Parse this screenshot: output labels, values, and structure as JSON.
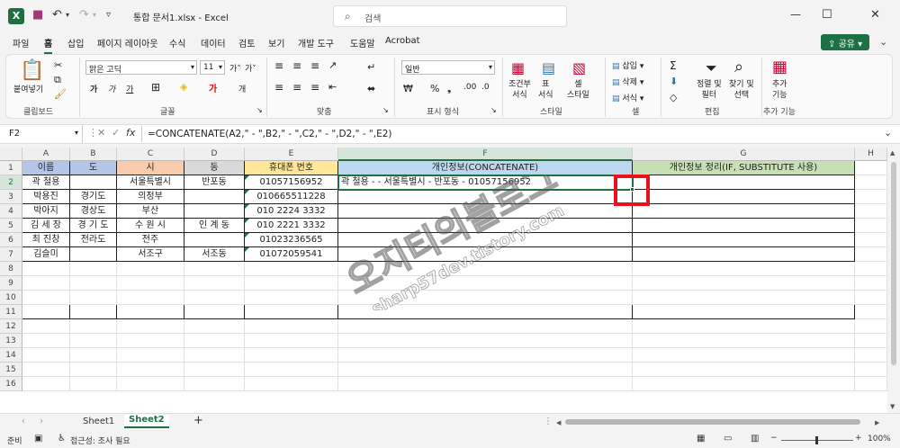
{
  "titlebar": {
    "doc_title": "통합 문서1.xlsx  -  Excel",
    "search_placeholder": "검색",
    "search_icon": "search-icon",
    "qat_icons": [
      "save-icon",
      "undo-icon",
      "redo-icon"
    ]
  },
  "menu": {
    "tabs": [
      "파일",
      "홈",
      "삽입",
      "페이지 레이아웃",
      "수식",
      "데이터",
      "검토",
      "보기",
      "개발 도구",
      "도움말",
      "Acrobat"
    ],
    "active": "홈",
    "share_label": "공유"
  },
  "ribbon": {
    "clipboard": {
      "paste": "붙여넣기",
      "label": "클립보드"
    },
    "font": {
      "name": "맑은 고딕",
      "size": "11",
      "bold": "가",
      "italic": "가",
      "underline": "가",
      "label": "글꼴"
    },
    "align": {
      "label": "맞춤"
    },
    "number": {
      "format": "일반",
      "label": "표시 형식"
    },
    "styles": {
      "cond_format": "조건부\n서식",
      "table_format": "표\n서식",
      "cell_style": "셀\n스타일",
      "label": "스타일"
    },
    "cells": {
      "insert": "삽입",
      "delete": "삭제",
      "format": "서식",
      "label": "셀"
    },
    "editing": {
      "sort_filter": "정렬 및\n필터",
      "find_select": "찾기 및\n선택",
      "label": "편집"
    },
    "addins": {
      "addins": "추가\n기능",
      "label": "추가 기능"
    }
  },
  "formula_bar": {
    "name_box": "F2",
    "fx": "fx",
    "formula": "=CONCATENATE(A2,\" - \",B2,\" - \",C2,\" - \",D2,\" - \",E2)"
  },
  "sheet": {
    "columns": [
      "A",
      "B",
      "C",
      "D",
      "E",
      "F",
      "G",
      "H"
    ],
    "selected_column": "F",
    "selected_row": "2",
    "rows": [
      "1",
      "2",
      "3",
      "4",
      "5",
      "6",
      "7",
      "8",
      "9",
      "10",
      "11",
      "12",
      "13",
      "14",
      "15",
      "16"
    ],
    "header_row": [
      "이름",
      "도",
      "시",
      "동",
      "휴대폰 번호",
      "개인정보(CONCATENATE)",
      "개인정보 정리(IF, SUBSTITUTE 사용)"
    ],
    "header_colors": [
      "#b4c6e7",
      "#b4c6e7",
      "#f8cbad",
      "#d9d9d9",
      "#ffe699",
      "#bdd7ee",
      "#c6e0b4"
    ],
    "data": [
      [
        "곽 철용",
        "",
        "서울특별시",
        "반포동",
        "01057156952",
        "곽 철용 -  - 서울특별시 - 반포동 - 01057156952",
        ""
      ],
      [
        "박용진",
        "경기도",
        "의정부",
        "",
        "010665511228",
        "",
        ""
      ],
      [
        "박아지",
        "경상도",
        "부산",
        "",
        "010 2224 3332",
        "",
        ""
      ],
      [
        "김 세 장",
        "경 기 도",
        "수 원 시",
        "인 계 동",
        "010 2221 3332",
        "",
        ""
      ],
      [
        "최 진창",
        "전라도",
        "전주",
        "",
        "01023236565",
        "",
        ""
      ],
      [
        "김슬미",
        "",
        "서조구",
        "서조동",
        "01072059541",
        "",
        ""
      ]
    ],
    "watermark": "오지티의블로그",
    "watermark_url": "sharp57dev.tistory.com"
  },
  "sheets": {
    "tabs": [
      "Sheet1",
      "Sheet2"
    ],
    "active": "Sheet2",
    "add": "+"
  },
  "status": {
    "ready": "준비",
    "accessibility": "접근성: 조사 필요",
    "zoom": "100%"
  }
}
